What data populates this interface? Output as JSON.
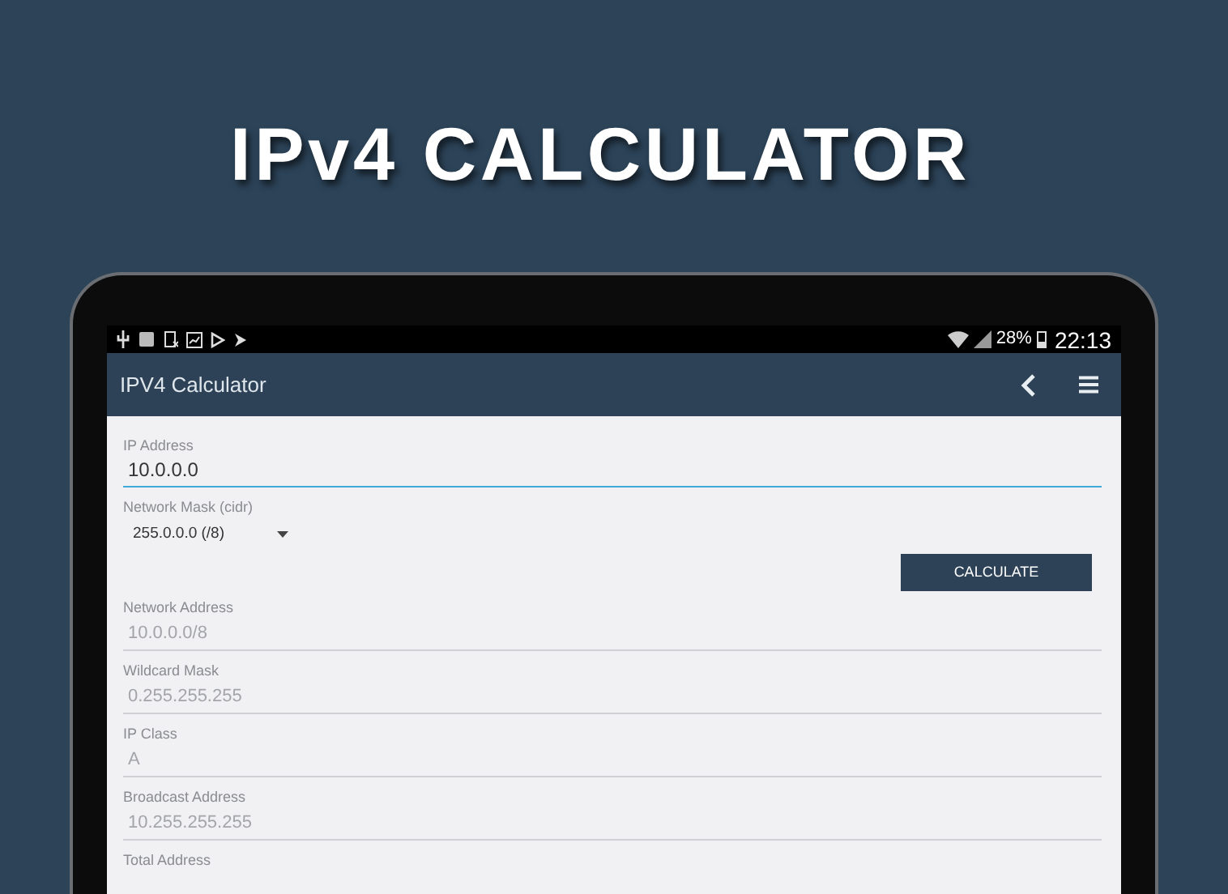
{
  "headline": "IPv4 CALCULATOR",
  "status_bar": {
    "battery": "28%",
    "time": "22:13"
  },
  "app_bar": {
    "title": "IPV4 Calculator"
  },
  "ip_field": {
    "label": "IP Address",
    "value": "10.0.0.0",
    "focused": true
  },
  "mask_dropdown": {
    "label": "Network Mask (cidr)",
    "value": "255.0.0.0 (/8)"
  },
  "calculate_button": "CALCULATE",
  "results": [
    {
      "label": "Network Address",
      "value": "10.0.0.0/8"
    },
    {
      "label": "Wildcard Mask",
      "value": "0.255.255.255"
    },
    {
      "label": "IP Class",
      "value": "A"
    },
    {
      "label": "Broadcast Address",
      "value": "10.255.255.255"
    },
    {
      "label": "Total Address"
    }
  ]
}
